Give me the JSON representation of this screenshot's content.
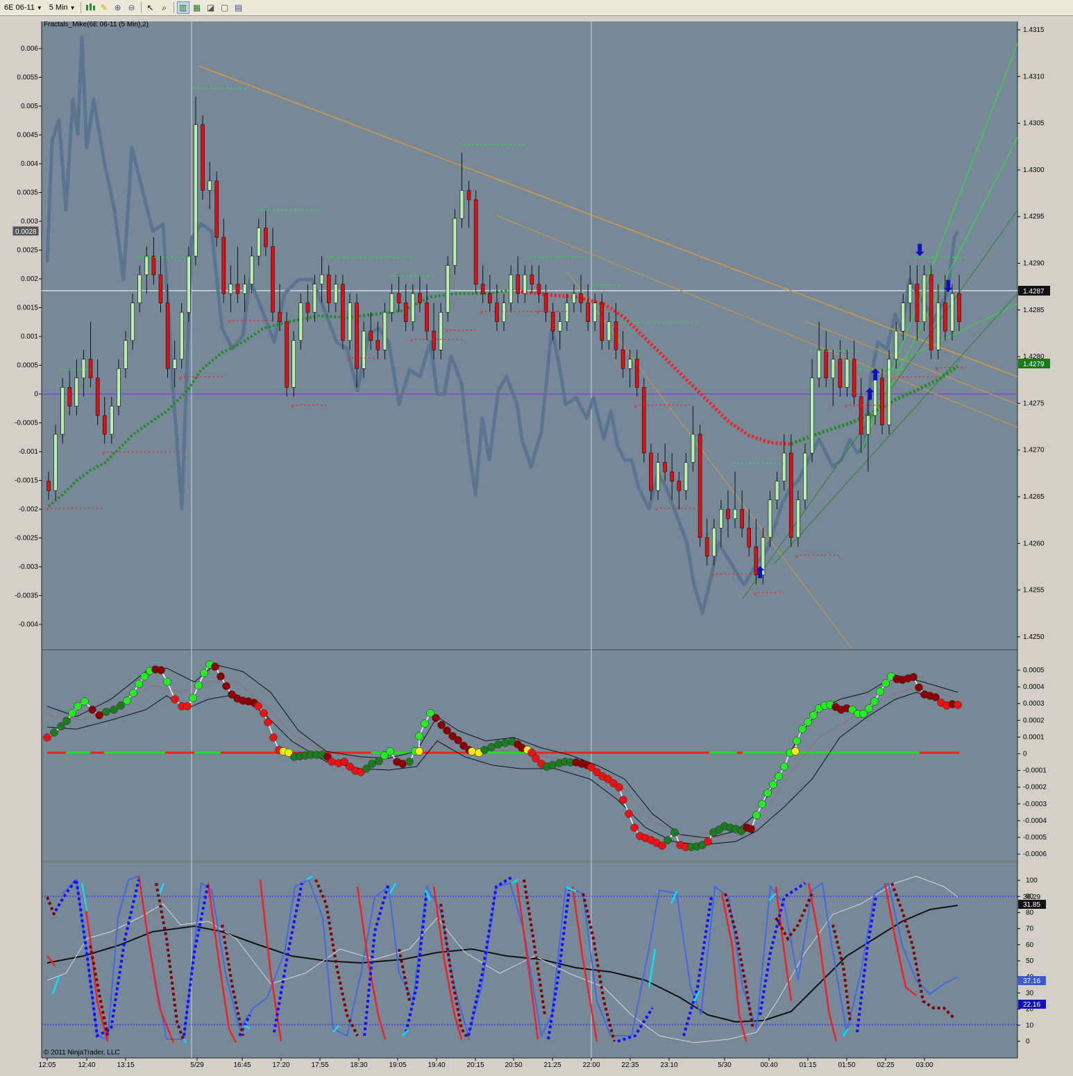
{
  "toolbar": {
    "instrument": "6E 06-11",
    "interval": "5 Min",
    "icons": [
      "candlestick-chart-icon",
      "pencil-draw-icon",
      "plus-zoom-icon",
      "minus-zoom-icon",
      "pointer-icon",
      "magnify-icon",
      "chart-style-icon",
      "bar-style-icon",
      "line-style-icon",
      "data-box-icon",
      "properties-icon"
    ]
  },
  "colors": {
    "panel_bg": "#778899",
    "candle_up": "#b8f0b0",
    "candle_down": "#dd1111",
    "fractal_up": "#22ee22",
    "fractal_down": "#ee2222",
    "trend_orange": "#e0a040",
    "trend_green": "#22dd22",
    "ma_red": "#ee2222",
    "ma_green": "#228b22",
    "zero_line": "#8a2be2",
    "osc_line": "#5a7590"
  },
  "indicator_label": "Fractals_Mike(6E 06-11 (5 Min),2)",
  "copyright": "© 2011 NinjaTrader, LLC",
  "price_axis": {
    "ticks": [
      "1.4315",
      "1.4310",
      "1.4305",
      "1.4300",
      "1.4295",
      "1.4290",
      "1.4285",
      "1.4280",
      "1.4275",
      "1.4270",
      "1.4265",
      "1.4260",
      "1.4255",
      "1.4250"
    ],
    "last_price": "1.4287",
    "ma_price": "1.4279"
  },
  "osc_axis": {
    "ticks": [
      "0.006",
      "0.0055",
      "0.005",
      "0.0045",
      "0.004",
      "0.0035",
      "0.003",
      "0.0025",
      "0.002",
      "0.0015",
      "0.001",
      "0.0005",
      "0",
      "-0.0005",
      "-0.001",
      "-0.0015",
      "-0.002",
      "-0.0025",
      "-0.003",
      "-0.0035",
      "-0.004"
    ],
    "current": "0.0028"
  },
  "macd_axis": {
    "ticks": [
      "0.0005",
      "0.0004",
      "0.0003",
      "0.0002",
      "0.0001",
      "0",
      "-0.0001",
      "-0.0002",
      "-0.0003",
      "-0.0004",
      "-0.0005",
      "-0.0006"
    ]
  },
  "stoch_axis": {
    "ticks": [
      "100",
      "90",
      "80",
      "70",
      "60",
      "50",
      "40",
      "30",
      "20",
      "10",
      "0"
    ],
    "badge_top": "36.29",
    "badge_black": "31.85",
    "badge_blue": "37.16",
    "badge_blue2": "22.16"
  },
  "time_axis": {
    "labels": [
      "12:05",
      "12:40",
      "13:15",
      "5/29",
      "16:45",
      "17:20",
      "17:55",
      "18:30",
      "19:05",
      "19:40",
      "20:15",
      "20:50",
      "21:25",
      "22:00",
      "22:35",
      "23:10",
      "5/30",
      "00:40",
      "01:15",
      "01:50",
      "02:25",
      "03:00"
    ]
  },
  "chart_data": {
    "type": "candlestick",
    "price_range": [
      1.4249,
      1.4316
    ],
    "candles": [
      [
        1.4267,
        1.4268,
        1.4265,
        1.4266
      ],
      [
        1.4266,
        1.4273,
        1.4265,
        1.4272
      ],
      [
        1.4272,
        1.4278,
        1.4271,
        1.4277
      ],
      [
        1.4277,
        1.4279,
        1.4274,
        1.4275
      ],
      [
        1.4275,
        1.428,
        1.4274,
        1.4278
      ],
      [
        1.4278,
        1.4281,
        1.4276,
        1.428
      ],
      [
        1.428,
        1.4284,
        1.4277,
        1.4278
      ],
      [
        1.4278,
        1.428,
        1.4273,
        1.4274
      ],
      [
        1.4274,
        1.4276,
        1.4271,
        1.4272
      ],
      [
        1.4272,
        1.4276,
        1.4271,
        1.4275
      ],
      [
        1.4275,
        1.428,
        1.4274,
        1.4279
      ],
      [
        1.4279,
        1.4283,
        1.4278,
        1.4282
      ],
      [
        1.4282,
        1.4287,
        1.4281,
        1.4286
      ],
      [
        1.4286,
        1.429,
        1.4285,
        1.4289
      ],
      [
        1.4289,
        1.4292,
        1.4287,
        1.4291
      ],
      [
        1.4291,
        1.4293,
        1.4288,
        1.4289
      ],
      [
        1.4289,
        1.4291,
        1.4285,
        1.4286
      ],
      [
        1.4286,
        1.4288,
        1.4278,
        1.4279
      ],
      [
        1.4279,
        1.4282,
        1.4277,
        1.428
      ],
      [
        1.428,
        1.4286,
        1.4279,
        1.4285
      ],
      [
        1.4285,
        1.4292,
        1.4284,
        1.4291
      ],
      [
        1.4291,
        1.4308,
        1.429,
        1.4305
      ],
      [
        1.4305,
        1.4306,
        1.4297,
        1.4298
      ],
      [
        1.4298,
        1.4301,
        1.4296,
        1.4299
      ],
      [
        1.4299,
        1.43,
        1.4292,
        1.4293
      ],
      [
        1.4293,
        1.4295,
        1.4286,
        1.4287
      ],
      [
        1.4287,
        1.429,
        1.4285,
        1.4288
      ],
      [
        1.4288,
        1.4292,
        1.4286,
        1.4287
      ],
      [
        1.4287,
        1.4289,
        1.4285,
        1.4288
      ],
      [
        1.4288,
        1.4292,
        1.4287,
        1.4291
      ],
      [
        1.4291,
        1.4295,
        1.429,
        1.4294
      ],
      [
        1.4294,
        1.4296,
        1.4291,
        1.4292
      ],
      [
        1.4292,
        1.4294,
        1.4284,
        1.4285
      ],
      [
        1.4285,
        1.4288,
        1.4283,
        1.4284
      ],
      [
        1.4284,
        1.4285,
        1.4276,
        1.4277
      ],
      [
        1.4277,
        1.4283,
        1.4276,
        1.4282
      ],
      [
        1.4282,
        1.4287,
        1.4281,
        1.4286
      ],
      [
        1.4286,
        1.4288,
        1.4284,
        1.4285
      ],
      [
        1.4285,
        1.4289,
        1.4284,
        1.4288
      ],
      [
        1.4288,
        1.4291,
        1.4286,
        1.4289
      ],
      [
        1.4289,
        1.429,
        1.4285,
        1.4286
      ],
      [
        1.4286,
        1.4289,
        1.4285,
        1.4288
      ],
      [
        1.4288,
        1.4289,
        1.4281,
        1.4282
      ],
      [
        1.4282,
        1.4287,
        1.4281,
        1.4286
      ],
      [
        1.4286,
        1.4287,
        1.4277,
        1.4279
      ],
      [
        1.4279,
        1.4284,
        1.4278,
        1.4283
      ],
      [
        1.4283,
        1.4285,
        1.4281,
        1.4282
      ],
      [
        1.4282,
        1.4284,
        1.428,
        1.4281
      ],
      [
        1.4281,
        1.4286,
        1.428,
        1.4285
      ],
      [
        1.4285,
        1.4288,
        1.4284,
        1.4287
      ],
      [
        1.4287,
        1.4289,
        1.4285,
        1.4286
      ],
      [
        1.4286,
        1.4288,
        1.4283,
        1.4284
      ],
      [
        1.4284,
        1.4288,
        1.4283,
        1.4287
      ],
      [
        1.4287,
        1.4289,
        1.4285,
        1.4286
      ],
      [
        1.4286,
        1.4288,
        1.4282,
        1.4283
      ],
      [
        1.4283,
        1.4286,
        1.428,
        1.4281
      ],
      [
        1.4281,
        1.4286,
        1.428,
        1.4285
      ],
      [
        1.4285,
        1.4291,
        1.4284,
        1.429
      ],
      [
        1.429,
        1.4296,
        1.4289,
        1.4295
      ],
      [
        1.4295,
        1.4302,
        1.4294,
        1.4298
      ],
      [
        1.4298,
        1.4299,
        1.4294,
        1.4297
      ],
      [
        1.4297,
        1.4298,
        1.4287,
        1.4288
      ],
      [
        1.4288,
        1.429,
        1.4286,
        1.4287
      ],
      [
        1.4287,
        1.4289,
        1.4285,
        1.4286
      ],
      [
        1.4286,
        1.4288,
        1.4283,
        1.4284
      ],
      [
        1.4284,
        1.4287,
        1.4283,
        1.4286
      ],
      [
        1.4286,
        1.429,
        1.4285,
        1.4289
      ],
      [
        1.4289,
        1.4291,
        1.4286,
        1.4287
      ],
      [
        1.4287,
        1.429,
        1.4286,
        1.4289
      ],
      [
        1.4289,
        1.429,
        1.4287,
        1.4288
      ],
      [
        1.4288,
        1.429,
        1.4286,
        1.4287
      ],
      [
        1.4287,
        1.4288,
        1.4284,
        1.4285
      ],
      [
        1.4285,
        1.4286,
        1.4282,
        1.4283
      ],
      [
        1.4283,
        1.4285,
        1.4281,
        1.4284
      ],
      [
        1.4284,
        1.4287,
        1.4283,
        1.4286
      ],
      [
        1.4286,
        1.4288,
        1.4285,
        1.4287
      ],
      [
        1.4287,
        1.4289,
        1.4285,
        1.4286
      ],
      [
        1.4286,
        1.4288,
        1.4283,
        1.4284
      ],
      [
        1.4284,
        1.4287,
        1.4283,
        1.4286
      ],
      [
        1.4286,
        1.4287,
        1.4281,
        1.4282
      ],
      [
        1.4282,
        1.4285,
        1.4281,
        1.4284
      ],
      [
        1.4284,
        1.4286,
        1.428,
        1.4281
      ],
      [
        1.4281,
        1.4283,
        1.4278,
        1.4279
      ],
      [
        1.4279,
        1.4281,
        1.4277,
        1.428
      ],
      [
        1.428,
        1.4281,
        1.4276,
        1.4277
      ],
      [
        1.4277,
        1.4278,
        1.4269,
        1.427
      ],
      [
        1.427,
        1.4271,
        1.4265,
        1.4266
      ],
      [
        1.4266,
        1.427,
        1.4265,
        1.4269
      ],
      [
        1.4269,
        1.4271,
        1.4267,
        1.4268
      ],
      [
        1.4268,
        1.427,
        1.4265,
        1.4267
      ],
      [
        1.4267,
        1.4268,
        1.4264,
        1.4266
      ],
      [
        1.4266,
        1.427,
        1.4265,
        1.4269
      ],
      [
        1.4269,
        1.4275,
        1.4268,
        1.4272
      ],
      [
        1.4272,
        1.4273,
        1.426,
        1.4261
      ],
      [
        1.4261,
        1.4263,
        1.4258,
        1.4259
      ],
      [
        1.4259,
        1.4263,
        1.4258,
        1.4262
      ],
      [
        1.4262,
        1.4265,
        1.426,
        1.4264
      ],
      [
        1.4264,
        1.4266,
        1.4261,
        1.4263
      ],
      [
        1.4263,
        1.4268,
        1.4262,
        1.4264
      ],
      [
        1.4264,
        1.4266,
        1.4261,
        1.4262
      ],
      [
        1.4262,
        1.4264,
        1.4259,
        1.426
      ],
      [
        1.426,
        1.4263,
        1.4256,
        1.4257
      ],
      [
        1.4257,
        1.4262,
        1.4256,
        1.4261
      ],
      [
        1.4261,
        1.4266,
        1.426,
        1.4265
      ],
      [
        1.4265,
        1.4268,
        1.4264,
        1.4267
      ],
      [
        1.4267,
        1.4272,
        1.4266,
        1.427
      ],
      [
        1.427,
        1.4272,
        1.426,
        1.4261
      ],
      [
        1.4261,
        1.4266,
        1.426,
        1.4265
      ],
      [
        1.4265,
        1.4271,
        1.4264,
        1.427
      ],
      [
        1.427,
        1.428,
        1.4269,
        1.4278
      ],
      [
        1.4278,
        1.4284,
        1.4277,
        1.4281
      ],
      [
        1.4281,
        1.4283,
        1.4277,
        1.4278
      ],
      [
        1.4278,
        1.4281,
        1.4275,
        1.428
      ],
      [
        1.428,
        1.4282,
        1.4276,
        1.4277
      ],
      [
        1.4277,
        1.4281,
        1.4276,
        1.428
      ],
      [
        1.428,
        1.4282,
        1.4275,
        1.4276
      ],
      [
        1.4276,
        1.4278,
        1.427,
        1.4272
      ],
      [
        1.4272,
        1.4276,
        1.4268,
        1.4274
      ],
      [
        1.4274,
        1.4279,
        1.4273,
        1.4278
      ],
      [
        1.4278,
        1.4279,
        1.4272,
        1.4273
      ],
      [
        1.4273,
        1.4281,
        1.4272,
        1.428
      ],
      [
        1.428,
        1.4284,
        1.4279,
        1.4283
      ],
      [
        1.4283,
        1.4287,
        1.4282,
        1.4286
      ],
      [
        1.4286,
        1.429,
        1.4284,
        1.4288
      ],
      [
        1.4288,
        1.429,
        1.4282,
        1.4284
      ],
      [
        1.4284,
        1.429,
        1.4283,
        1.4289
      ],
      [
        1.4289,
        1.429,
        1.428,
        1.4281
      ],
      [
        1.4281,
        1.4288,
        1.428,
        1.4286
      ],
      [
        1.4286,
        1.4289,
        1.4282,
        1.4283
      ],
      [
        1.4283,
        1.4288,
        1.4282,
        1.4287
      ],
      [
        1.4287,
        1.4289,
        1.4283,
        1.4284
      ]
    ]
  }
}
